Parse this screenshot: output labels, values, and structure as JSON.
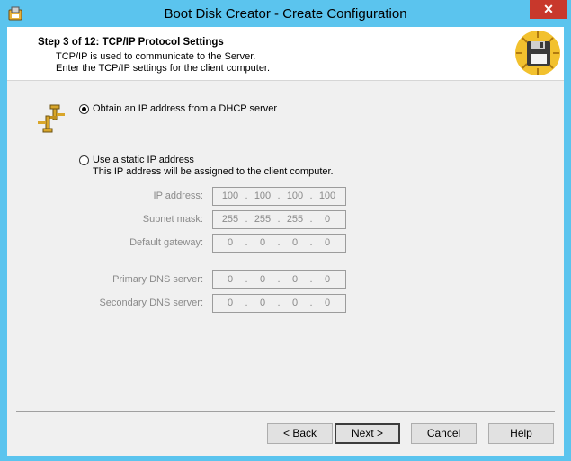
{
  "window": {
    "title": "Boot Disk Creator - Create Configuration",
    "close_glyph": "✕"
  },
  "header": {
    "step": "Step 3 of 12: TCP/IP Protocol Settings",
    "line1": "TCP/IP is used to communicate to the Server.",
    "line2": "Enter the TCP/IP settings for the client computer."
  },
  "dhcp": {
    "label": "Obtain an IP address from a DHCP server",
    "selected": true
  },
  "static": {
    "label": "Use a static IP address",
    "note": "This IP address will be assigned to the client computer.",
    "selected": false
  },
  "fields": [
    {
      "label": "IP address:",
      "octets": [
        "100",
        "100",
        "100",
        "100"
      ]
    },
    {
      "label": "Subnet mask:",
      "octets": [
        "255",
        "255",
        "255",
        "0"
      ]
    },
    {
      "label": "Default gateway:",
      "octets": [
        "0",
        "0",
        "0",
        "0"
      ]
    },
    {
      "label": "Primary DNS server:",
      "octets": [
        "0",
        "0",
        "0",
        "0"
      ]
    },
    {
      "label": "Secondary DNS server:",
      "octets": [
        "0",
        "0",
        "0",
        "0"
      ]
    }
  ],
  "buttons": {
    "back": "< Back",
    "next": "Next >",
    "cancel": "Cancel",
    "help": "Help"
  }
}
